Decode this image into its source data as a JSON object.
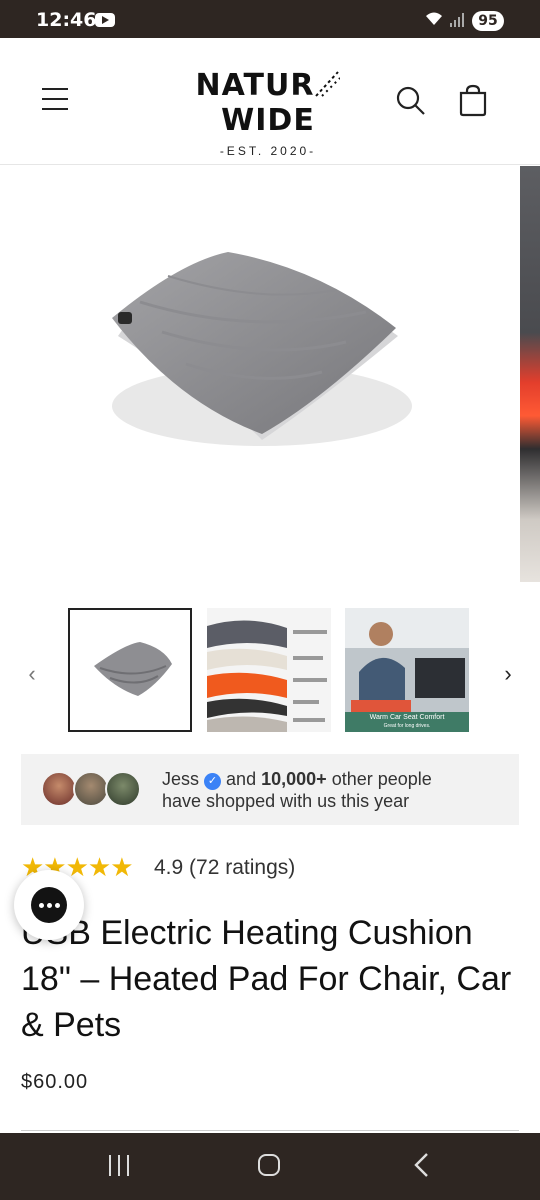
{
  "status_bar": {
    "time": "12:46",
    "battery": "95"
  },
  "header": {
    "logo_left": "NATUR",
    "logo_right": "WIDE",
    "logo_tagline": "-EST. 2020-"
  },
  "gallery": {
    "thumbnails": [
      {
        "caption": ""
      },
      {
        "caption": ""
      },
      {
        "caption": "Warm Car Seat Comfort",
        "subcaption": "Great for long drives."
      }
    ]
  },
  "social_proof": {
    "name": "Jess",
    "middle": "and",
    "count": "10,000+",
    "line1_end": "other people",
    "line2": "have shopped with us this year"
  },
  "rating": {
    "stars": "★★★★★",
    "value": 4.9,
    "text": "4.9 (72 ratings)"
  },
  "product": {
    "title": "USB Electric Heating Cushion 18\" – Heated Pad For Chair, Car & Pets",
    "price": "$60.00"
  },
  "colors": {
    "status_bar": "#2e2622",
    "star": "#f1b806",
    "verified": "#3b82f6"
  }
}
